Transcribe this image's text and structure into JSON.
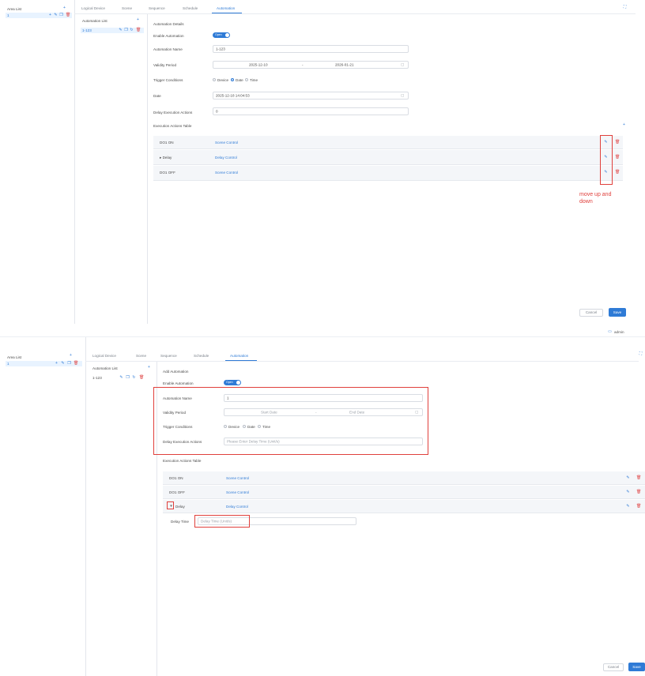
{
  "shot1": {
    "area_list": {
      "title": "Area List",
      "add_icon": "plus-icon",
      "item_label": "1"
    },
    "tabs": [
      "Logical Device",
      "Scene",
      "Sequence",
      "Schedule",
      "Automation"
    ],
    "active_tab": "Automation",
    "automation_list": {
      "title": "Automation List",
      "item_label": "1-123"
    },
    "section_title": "Automation Details",
    "fields": {
      "enable_label": "Enable Automation",
      "toggle_text": "Open",
      "name_label": "Automation Name",
      "name_value": "1-123",
      "validity_label": "Validity Period",
      "validity_start": "2025-12-10",
      "validity_sep": "-",
      "validity_end": "2026-01-21",
      "trigger_label": "Trigger Conditions",
      "trigger_options": [
        "Device",
        "Date",
        "Time"
      ],
      "trigger_selected": "Date",
      "date_label": "Date",
      "date_value": "2025-12-18 14:04:53",
      "delay_label": "Delay Execution Actions",
      "delay_value": "0"
    },
    "actions_title": "Execution Actions Table",
    "actions": [
      {
        "name": "DO1 ON",
        "type": "Scene Control"
      },
      {
        "name": "▸  Delay",
        "type": "Delay Control"
      },
      {
        "name": "DO1 OFF",
        "type": "Scene Control"
      }
    ],
    "annotation": "move up and\ndown",
    "cancel_label": "Cancel",
    "save_label": "Save"
  },
  "shot2": {
    "header_right_text": "admin",
    "area_list": {
      "title": "Area List",
      "item_label": "1"
    },
    "tabs": [
      "Logical Device",
      "Scene",
      "Sequence",
      "Schedule",
      "Automation"
    ],
    "active_tab": "Automation",
    "automation_list": {
      "title": "Automation List",
      "item_label": "1-123"
    },
    "section_title": "Add Automation",
    "fields": {
      "enable_label": "Enable Automation",
      "toggle_text": "Open",
      "name_label": "Automation Name",
      "name_value": "1",
      "validity_label": "Validity Period",
      "validity_start_ph": "Start Date",
      "validity_sep": "-",
      "validity_end_ph": "End Date",
      "trigger_label": "Trigger Conditions",
      "trigger_options": [
        "Device",
        "Date",
        "Time"
      ],
      "delay_label": "Delay Execution Actions",
      "delay_ph": "Please Enter Delay Time (Unit/s)"
    },
    "actions_title": "Execution Actions Table",
    "actions": [
      {
        "name": "DO1 ON",
        "type": "Scene Control"
      },
      {
        "name": "DO1 OFF",
        "type": "Scene Control"
      },
      {
        "name": "Delay",
        "type": "Delay Control"
      }
    ],
    "delay_time_label": "Delay Time",
    "delay_time_ph": "Delay Time (Unit/s)",
    "cancel_label": "Cancel",
    "save_label": "Save"
  },
  "colors": {
    "accent": "#2f7bd6",
    "danger": "#e04d4d",
    "annotation": "#e0403c",
    "selected_bg": "#e8f3ff"
  },
  "icons": [
    "plus-icon",
    "edit-icon",
    "copy-icon",
    "refresh-icon",
    "delete-icon",
    "calendar-icon",
    "expand-icon",
    "fullscreen-icon",
    "user-icon"
  ]
}
